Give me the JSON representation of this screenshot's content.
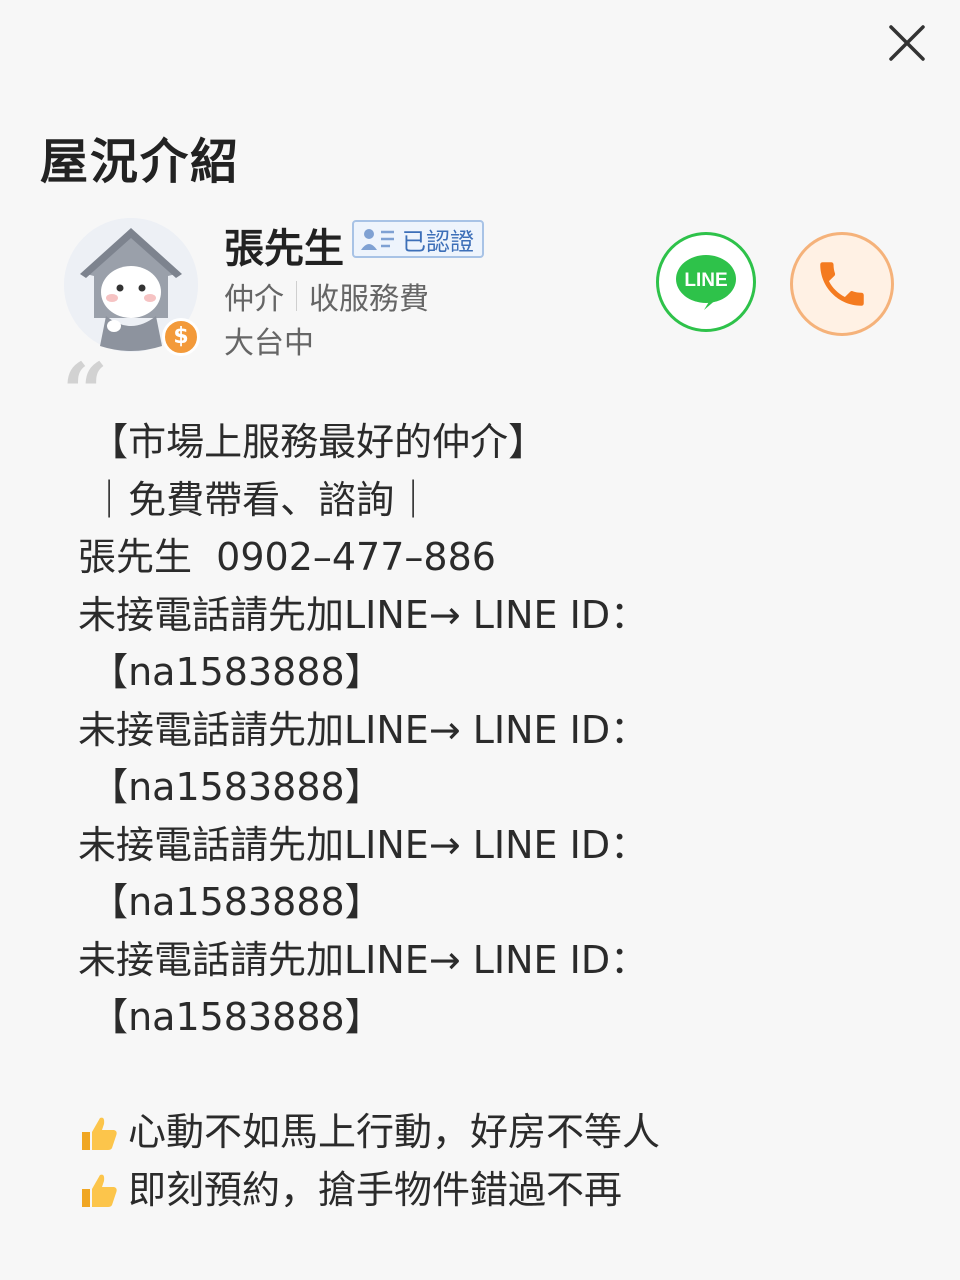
{
  "header": {
    "title": "屋況介紹"
  },
  "agent": {
    "name": "張先生",
    "verified_label": "已認證",
    "role": "仲介",
    "fee": "收服務費",
    "region": "大台中",
    "fee_badge": "$",
    "line_label": "LINE"
  },
  "description": {
    "lines": [
      " 【市場上服務最好的仲介】",
      " ｜免費帶看、諮詢｜",
      "張先生  0902–477–886",
      "未接電話請先加LINE→ LINE ID：",
      " 【na1583888】",
      "未接電話請先加LINE→ LINE ID：",
      " 【na1583888】",
      "未接電話請先加LINE→ LINE ID：",
      " 【na1583888】",
      "未接電話請先加LINE→ LINE ID：",
      " 【na1583888】",
      "",
      "心動不如馬上行動，好房不等人",
      "即刻預約，搶手物件錯過不再"
    ]
  },
  "colors": {
    "line_green": "#2ec24a",
    "phone_orange": "#f47b20",
    "badge_blue": "#3d6fb8"
  },
  "icons": {
    "close": "close-icon",
    "line": "line-icon",
    "phone": "phone-icon",
    "thumb": "thumbs-up-icon",
    "verified": "id-card-icon"
  }
}
